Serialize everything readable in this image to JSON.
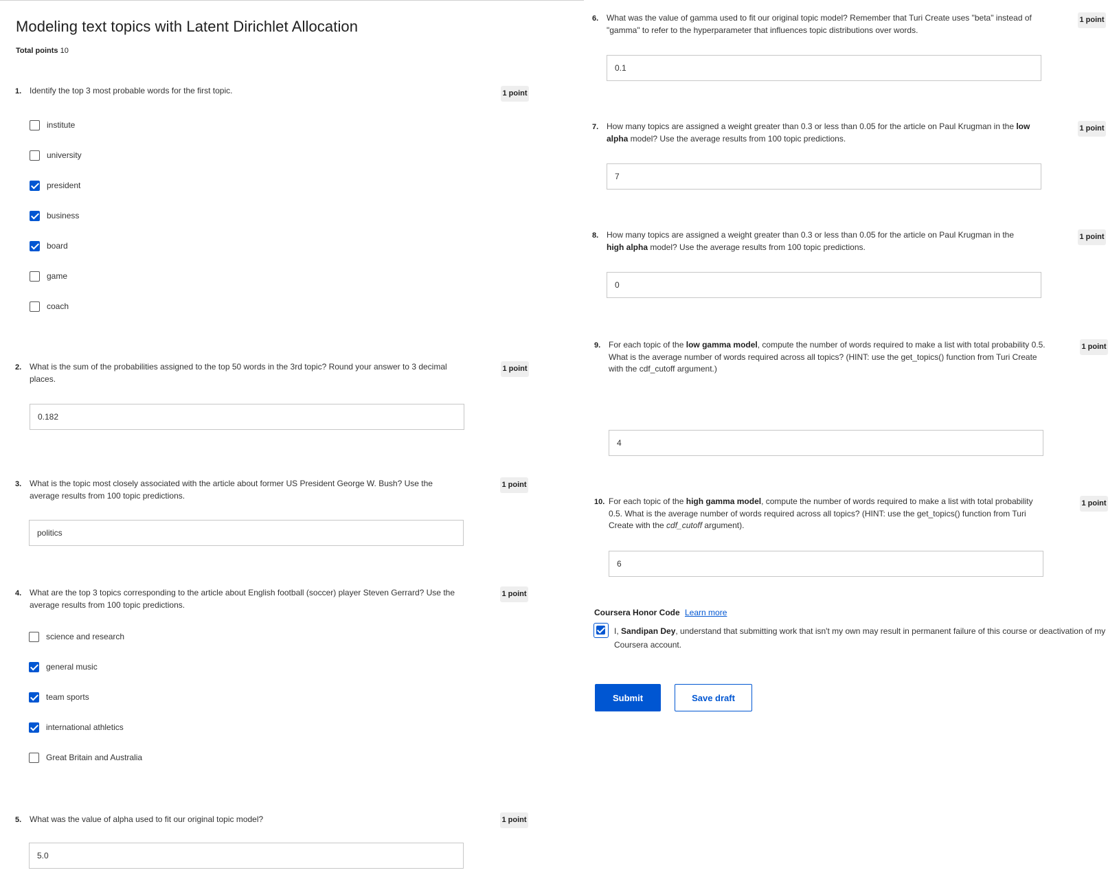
{
  "quiz": {
    "title": "Modeling text topics with Latent Dirichlet Allocation",
    "total_points_label": "Total points",
    "total_points_value": "10"
  },
  "questions": [
    {
      "number": "1.",
      "text": "Identify the top 3 most probable words for the first topic.",
      "points": "1 point",
      "options": [
        {
          "label": "institute",
          "checked": false
        },
        {
          "label": "university",
          "checked": false
        },
        {
          "label": "president",
          "checked": true
        },
        {
          "label": "business",
          "checked": true
        },
        {
          "label": "board",
          "checked": true
        },
        {
          "label": "game",
          "checked": false
        },
        {
          "label": "coach",
          "checked": false
        }
      ]
    },
    {
      "number": "2.",
      "text": "What is the sum of the probabilities assigned to the top 50 words in the 3rd topic? Round your answer to 3 decimal places.",
      "points": "1 point",
      "answer": "0.182"
    },
    {
      "number": "3.",
      "text": "What is the topic most closely associated with the article about former US President George W. Bush? Use the average results from 100 topic predictions.",
      "points": "1 point",
      "answer": "politics"
    },
    {
      "number": "4.",
      "text": "What are the top 3 topics corresponding to the article about English football (soccer) player Steven Gerrard? Use the average results from 100 topic predictions.",
      "points": "1 point",
      "options": [
        {
          "label": "science and research",
          "checked": false
        },
        {
          "label": "general music",
          "checked": true
        },
        {
          "label": "team sports",
          "checked": true
        },
        {
          "label": "international athletics",
          "checked": true
        },
        {
          "label": "Great Britain and Australia",
          "checked": false
        }
      ]
    },
    {
      "number": "5.",
      "text": "What was the value of alpha used to fit our original topic model?",
      "points": "1 point",
      "answer": "5.0"
    },
    {
      "number": "6.",
      "text": "What was the value of gamma used to fit our original topic model? Remember that Turi Create uses \"beta\" instead of \"gamma\" to refer to the hyperparameter that influences topic distributions over words.",
      "points": "1 point",
      "answer": "0.1"
    },
    {
      "number": "7.",
      "text_parts": [
        "How many topics are assigned a weight greater than 0.3 or less than 0.05 for the article on Paul Krugman in the ",
        "low alpha",
        " model? Use the average results from 100 topic predictions."
      ],
      "points": "1 point",
      "answer": "7"
    },
    {
      "number": "8.",
      "text_parts": [
        "How many topics are assigned a weight greater than 0.3 or less than 0.05 for the article on Paul Krugman in the ",
        "high alpha",
        " model? Use the average results from 100 topic predictions."
      ],
      "points": "1 point",
      "answer": "0"
    },
    {
      "number": "9.",
      "text_parts": [
        "For each topic of the ",
        "low gamma model",
        ", compute the number of words required to make a list with total probability 0.5. What is the average number of words required across all topics? (HINT: use the get_topics() function from Turi Create with the cdf_cutoff argument.)"
      ],
      "points": "1 point",
      "answer": "4"
    },
    {
      "number": "10.",
      "text_parts": [
        "For each topic of the ",
        "high gamma model",
        ", compute the number of words required to make a list with total probability 0.5. What is the average number of words required across all topics? (HINT: use the get_topics() function from Turi Create with the ",
        "cdf_cutoff",
        " argument)."
      ],
      "points": "1 point",
      "answer": "6"
    }
  ],
  "honor": {
    "title": "Coursera Honor Code",
    "link": "Learn more",
    "text_pre": "I, ",
    "name": "Sandipan Dey",
    "text_post": ", understand that submitting work that isn't my own may result in permanent failure of this course or deactivation of my Coursera account.",
    "checked": true
  },
  "buttons": {
    "submit": "Submit",
    "save_draft": "Save draft"
  },
  "colors": {
    "accent": "#0056d2"
  }
}
